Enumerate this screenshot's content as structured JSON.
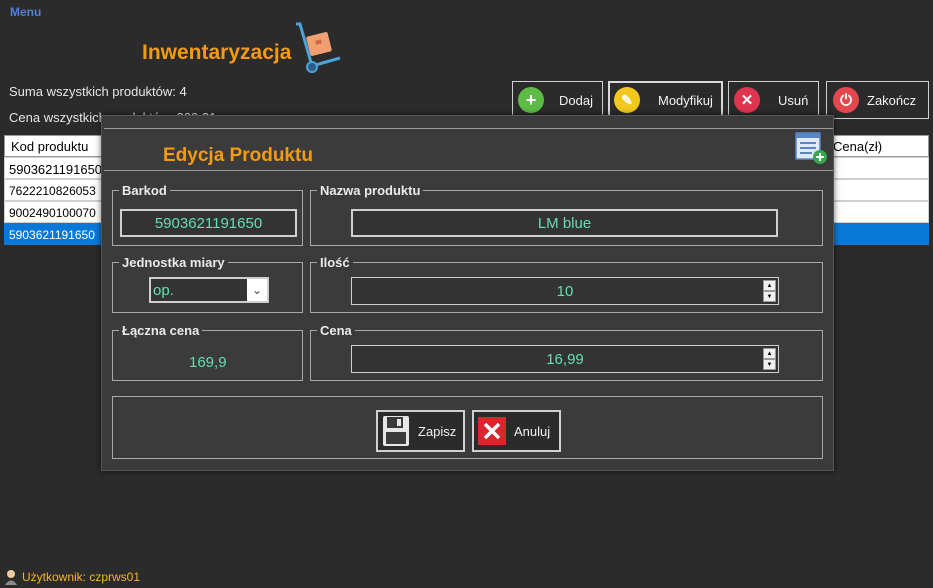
{
  "menu": {
    "label": "Menu"
  },
  "app": {
    "title": "Inwentaryzacja"
  },
  "stats": {
    "sum_label": "Suma wszystkich produktów: 4",
    "price_label": "Cena wszystkich produktów: 209,21"
  },
  "toolbar": {
    "add": "Dodaj",
    "modify": "Modyfikuj",
    "delete": "Usuń",
    "end": "Zakończ"
  },
  "grid": {
    "col_code": "Kod produktu",
    "col_price": "Cena(zł)",
    "rows": [
      {
        "code": "5903621191650"
      },
      {
        "code": "7622210826053"
      },
      {
        "code": "9002490100070"
      },
      {
        "code": "5903621191650"
      }
    ]
  },
  "dialog": {
    "title": "Edycja Produktu",
    "barcode": {
      "label": "Barkod",
      "value": "5903621191650"
    },
    "name": {
      "label": "Nazwa produktu",
      "value": "LM blue"
    },
    "unit": {
      "label": "Jednostka miary",
      "value": "op."
    },
    "qty": {
      "label": "Ilość",
      "value": "10"
    },
    "total": {
      "label": "Łączna cena",
      "value": "169,9"
    },
    "price": {
      "label": "Cena",
      "value": "16,99"
    },
    "save": "Zapisz",
    "cancel": "Anuluj"
  },
  "status": {
    "user": "Użytkownik: czprws01"
  },
  "colors": {
    "accent": "#f59a11",
    "value_text": "#63e0b0",
    "selection": "#0a78d7",
    "user_text": "#f5b623"
  }
}
